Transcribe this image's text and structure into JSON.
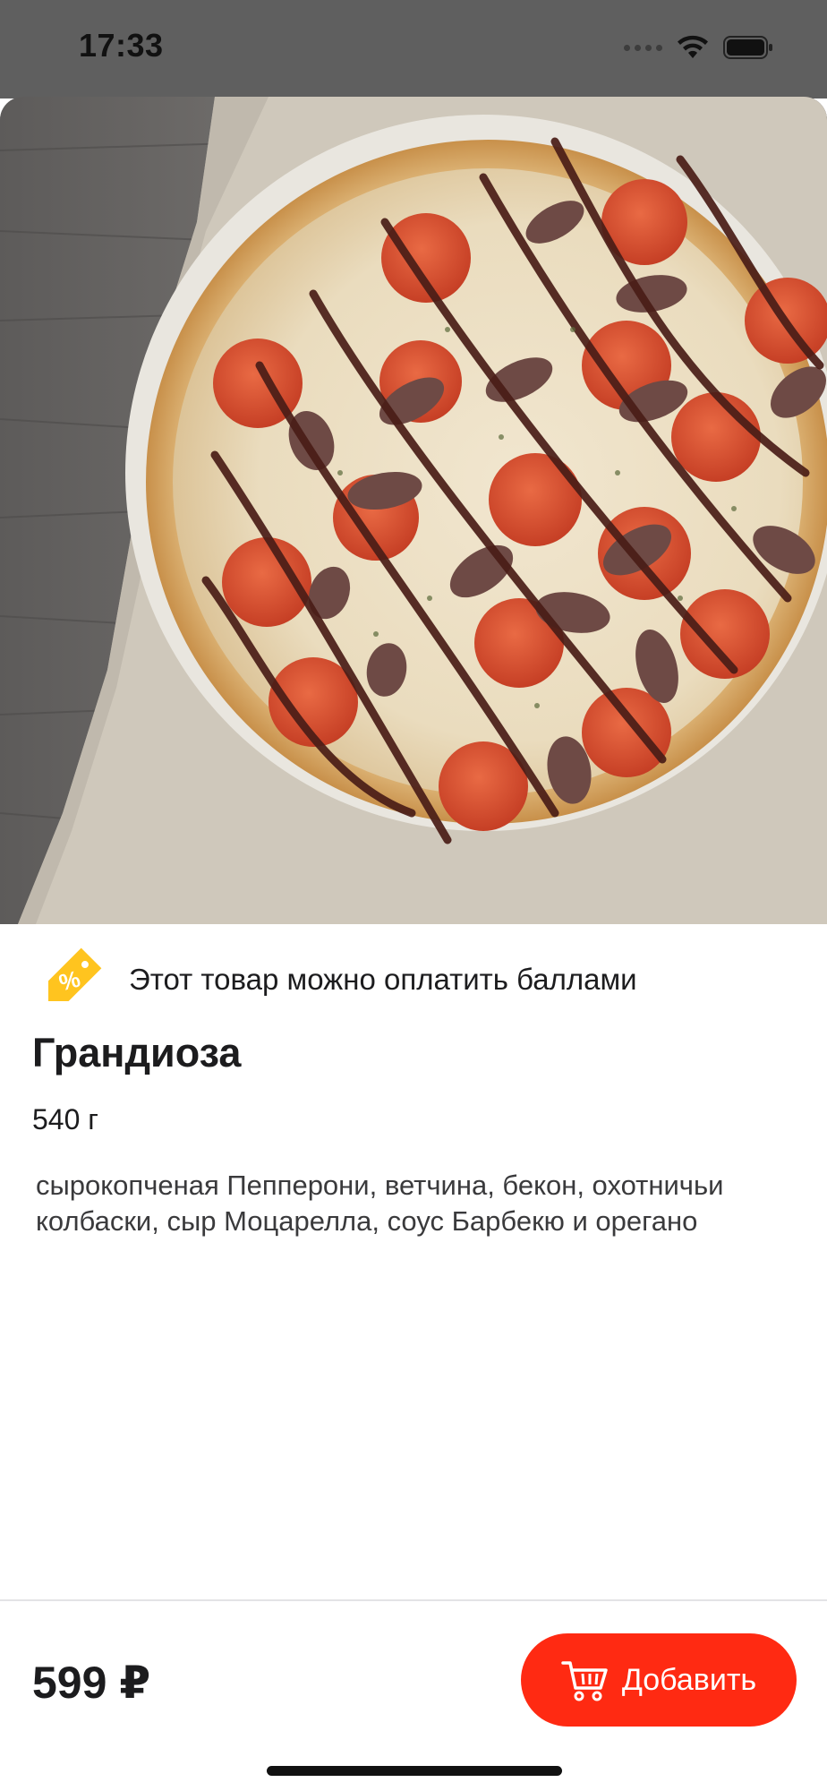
{
  "status_bar": {
    "time": "17:33"
  },
  "product": {
    "image_alt": "Pizza Grandioza",
    "points_note": "Этот товар можно оплатить баллами",
    "title": "Грандиоза",
    "weight": "540 г",
    "description": "сырокопченая Пепперони, ветчина, бекон, охотничьи колбаски,  сыр Моцарелла, соус Барбекю и орегано"
  },
  "bottom_bar": {
    "price": "599 ₽",
    "add_label": "Добавить"
  },
  "icons": {
    "points": "discount-tag-icon",
    "cart": "cart-icon",
    "wifi": "wifi-icon",
    "battery": "battery-icon",
    "signal": "signal-icon"
  },
  "colors": {
    "accent": "#ff2a12",
    "points_tag": "#ffc41f",
    "status_bar": "#5f5f5f"
  }
}
